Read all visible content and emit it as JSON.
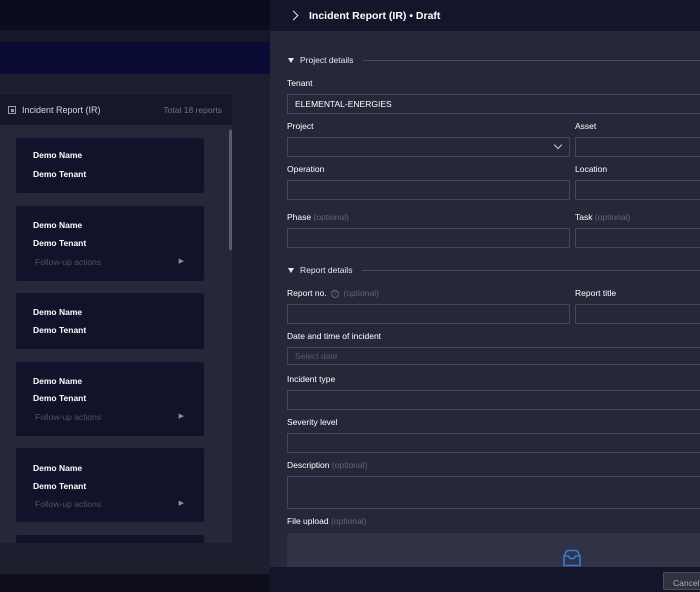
{
  "background": {
    "panel_title": "Incident Report (IR)",
    "panel_total": "Total 18 reports",
    "cards": [
      {
        "name": "Demo Name",
        "tenant": "Demo Tenant",
        "follow_up": ""
      },
      {
        "name": "Demo Name",
        "tenant": "Demo Tenant",
        "follow_up": "Follow-up actions"
      },
      {
        "name": "Demo Name",
        "tenant": "Demo Tenant",
        "follow_up": ""
      },
      {
        "name": "Demo Name",
        "tenant": "Demo Tenant",
        "follow_up": "Follow-up actions"
      },
      {
        "name": "Demo Name",
        "tenant": "Demo Tenant",
        "follow_up": "Follow-up actions"
      }
    ]
  },
  "drawer": {
    "title": "Incident Report (IR) • Draft",
    "project_section": {
      "label": "Project details",
      "tenant_label": "Tenant",
      "tenant_value": "ELEMENTAL-ENERGIES",
      "project_label": "Project",
      "asset_label": "Asset",
      "operation_label": "Operation",
      "location_label": "Location",
      "phase_label": "Phase",
      "task_label": "Task",
      "optional": "(optional)"
    },
    "report_section": {
      "label": "Report details",
      "report_no_label": "Report no.",
      "report_title_label": "Report title",
      "datetime_label": "Date and time of incident",
      "datetime_placeholder": "Select date",
      "incident_type_label": "Incident type",
      "severity_label": "Severity level",
      "description_label": "Description",
      "file_upload_label": "File upload",
      "optional": "(optional)"
    },
    "footer": {
      "cancel_label": "Cancel"
    }
  },
  "icons": {
    "collapse": "chevron-right-icon",
    "section_toggle": "caret-down-icon",
    "dropdown": "chevron-down-icon",
    "help": "question-circle-icon",
    "upload": "inbox-tray-icon",
    "follow_up_arrow": "caret-right-icon"
  },
  "colors": {
    "accent_upload": "#3a7bd5",
    "drawer_bg": "#262839",
    "header_bg": "#13152a"
  }
}
